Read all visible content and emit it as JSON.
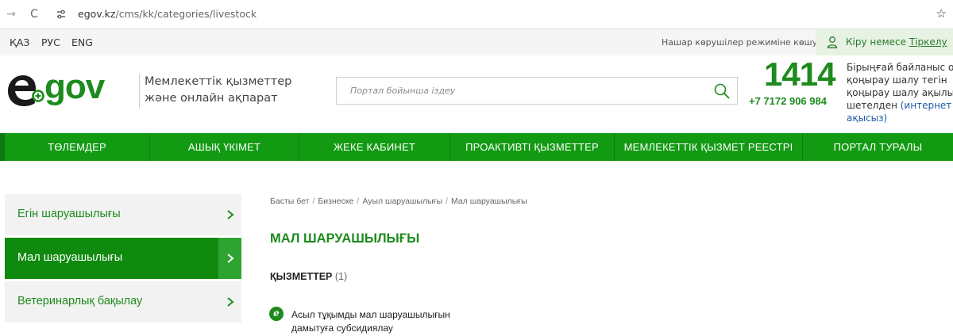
{
  "browser": {
    "url_host": "egov.kz",
    "url_path": "/cms/kk/categories/livestock"
  },
  "utility": {
    "languages": [
      "ҚАЗ",
      "РУС",
      "ENG"
    ],
    "low_vision": "Нашар көрушілер режиміне көшу",
    "login_label": "Кіру немесе ",
    "register_label": "Тіркелу"
  },
  "header": {
    "logo_text": "egov",
    "tagline_line1": "Мемлекеттік қызметтер",
    "tagline_line2": "және онлайн ақпарат",
    "search_placeholder": "Портал бойынша іздеу",
    "phone_short": "1414",
    "phone_full": "+7 7172 906 984",
    "contact_line1": "Бірыңғай байланыс ор",
    "contact_line2": "қоңырау шалу тегін",
    "contact_line3": "қоңырау шалу ақылы",
    "contact_line4_prefix": "шетелден ",
    "contact_line4_link": "(интернет ар",
    "contact_line5": "ақысыз)"
  },
  "nav": {
    "items": [
      "ТӨЛЕМДЕР",
      "АШЫҚ ҮКІМЕТ",
      "ЖЕКЕ КАБИНЕТ",
      "ПРОАКТИВТІ ҚЫЗМЕТТЕР",
      "МЕМЛЕКЕТТІК ҚЫЗМЕТ РЕЕСТРІ",
      "ПОРТАЛ ТУРАЛЫ"
    ]
  },
  "sidebar": {
    "items": [
      {
        "label": "Егін шаруашылығы"
      },
      {
        "label": "Мал шаруашылығы"
      },
      {
        "label": "Ветеринарлық бақылау"
      }
    ]
  },
  "breadcrumb": [
    "Басты бет",
    "Бизнеске",
    "Ауыл шаруашылығы",
    "Мал шаруашылығы"
  ],
  "content": {
    "title": "МАЛ ШАРУАШЫЛЫҒЫ",
    "services_heading": "ҚЫЗМЕТТЕР",
    "services_count": "(1)",
    "service_icon_letter": "e",
    "service_line1": "Асыл тұқымды мал шаруашылығын",
    "service_line2": "дамытуға субсидиялау"
  },
  "colors": {
    "brand_green": "#1d8b1d",
    "nav_green": "#139a13",
    "active_green": "#0f8a0f",
    "link_blue": "#1e5aa8"
  }
}
